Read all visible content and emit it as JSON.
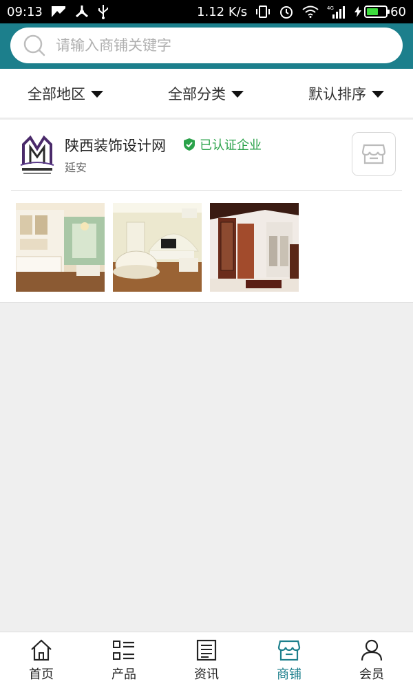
{
  "status_bar": {
    "time": "09:13",
    "speed": "1.12 K/s",
    "network": "4G",
    "battery": "60"
  },
  "search": {
    "placeholder": "请输入商铺关键字",
    "value": ""
  },
  "filters": [
    {
      "label": "全部地区"
    },
    {
      "label": "全部分类"
    },
    {
      "label": "默认排序"
    }
  ],
  "shop": {
    "name": "陕西装饰设计网",
    "verified_label": "已认证企业",
    "region": "延安",
    "logo_icon": "shop-logo-icon",
    "enter_icon": "store-icon"
  },
  "bottom_nav": [
    {
      "label": "首页",
      "icon": "home-icon"
    },
    {
      "label": "产品",
      "icon": "list-icon"
    },
    {
      "label": "资讯",
      "icon": "news-icon"
    },
    {
      "label": "商铺",
      "icon": "store-icon"
    },
    {
      "label": "会员",
      "icon": "user-icon"
    }
  ],
  "colors": {
    "accent": "#1c7f8c",
    "verified": "#2aa24a"
  }
}
